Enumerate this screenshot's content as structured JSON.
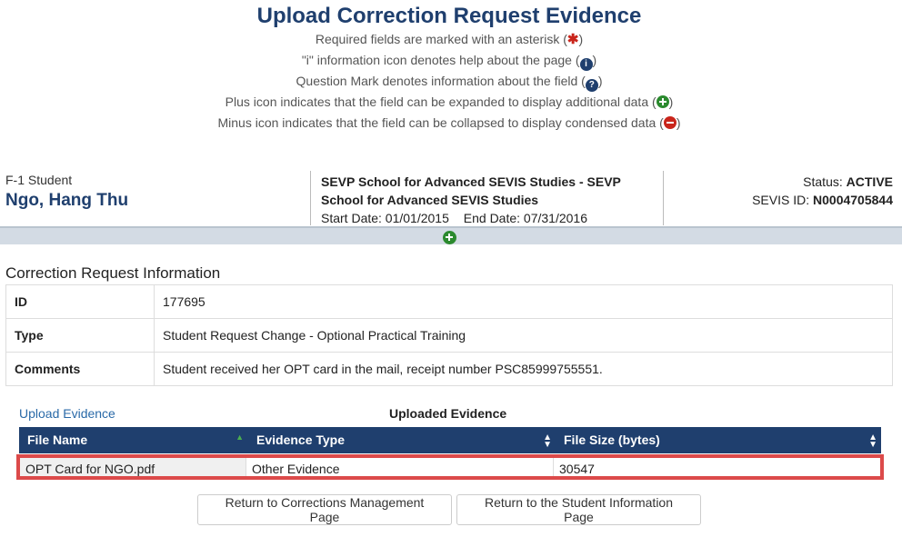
{
  "page": {
    "title": "Upload Correction Request Evidence"
  },
  "legend": [
    {
      "text": "Required fields are marked with an asterisk (",
      "icon": "asterisk-icon",
      "close": ")"
    },
    {
      "text": "\"i\" information icon denotes help about the page (",
      "icon": "info-icon",
      "close": ")"
    },
    {
      "text": "Question Mark denotes information about the field (",
      "icon": "question-icon",
      "close": ")"
    },
    {
      "text": "Plus icon indicates that the field can be expanded to display additional data (",
      "icon": "plus-icon",
      "close": ")"
    },
    {
      "text": "Minus icon indicates that the field can be collapsed to display condensed data (",
      "icon": "minus-icon",
      "close": ")"
    }
  ],
  "student": {
    "type": "F-1 Student",
    "name": "Ngo, Hang Thu",
    "school": "SEVP School for Advanced SEVIS Studies - SEVP School for Advanced SEVIS Studies",
    "start_date": "Start Date: 01/01/2015",
    "end_date": "End Date: 07/31/2016",
    "status_label": "Status:",
    "status_value": "ACTIVE",
    "sevis_label": "SEVIS ID:",
    "sevis_value": "N0004705844"
  },
  "correction": {
    "section_title": "Correction Request Information",
    "rows": [
      {
        "label": "ID",
        "value": "177695"
      },
      {
        "label": "Type",
        "value": "Student Request Change - Optional Practical Training"
      },
      {
        "label": "Comments",
        "value": "Student received her OPT card in the mail, receipt number PSC85999755551."
      }
    ]
  },
  "evidence": {
    "upload_link": "Upload Evidence",
    "title": "Uploaded Evidence",
    "columns": [
      "File Name",
      "Evidence Type",
      "File Size (bytes)"
    ],
    "rows": [
      {
        "file_name": "OPT Card for NGO.pdf",
        "evidence_type": "Other Evidence",
        "file_size": "30547"
      }
    ]
  },
  "buttons": {
    "return_corrections": "Return to Corrections Management Page",
    "return_student": "Return to the Student Information Page"
  },
  "colors": {
    "title": "#1f3f6e",
    "header_bar": "#1f3f6e",
    "highlight_border": "#dc4a4a",
    "link": "#2a6aa8"
  }
}
